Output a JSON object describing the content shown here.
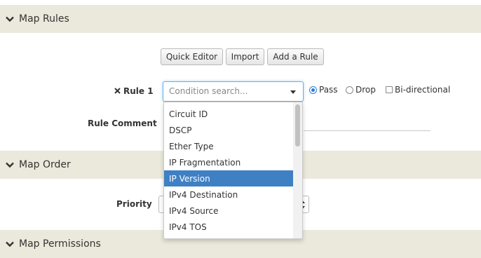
{
  "sections": {
    "map_rules": "Map Rules",
    "map_order": "Map Order",
    "map_permissions": "Map Permissions"
  },
  "toolbar": {
    "quick_editor": "Quick Editor",
    "import": "Import",
    "add_rule": "Add a Rule"
  },
  "rule": {
    "label": "Rule 1",
    "condition_placeholder": "Condition search...",
    "options": {
      "pass": "Pass",
      "drop": "Drop",
      "bidirectional": "Bi-directional"
    },
    "selected_action": "Pass",
    "bidirectional_checked": false,
    "comment_label": "Rule Comment"
  },
  "priority": {
    "label": "Priority"
  },
  "dropdown": {
    "items": [
      "Circuit ID",
      "DSCP",
      "Ether Type",
      "IP Fragmentation",
      "IP Version",
      "IPv4 Destination",
      "IPv4 Source",
      "IPv4 TOS"
    ],
    "highlighted": "IP Version"
  },
  "colors": {
    "section_bg": "#ebe9dc",
    "highlight": "#3f80c4",
    "focus_border": "#66afe9"
  }
}
